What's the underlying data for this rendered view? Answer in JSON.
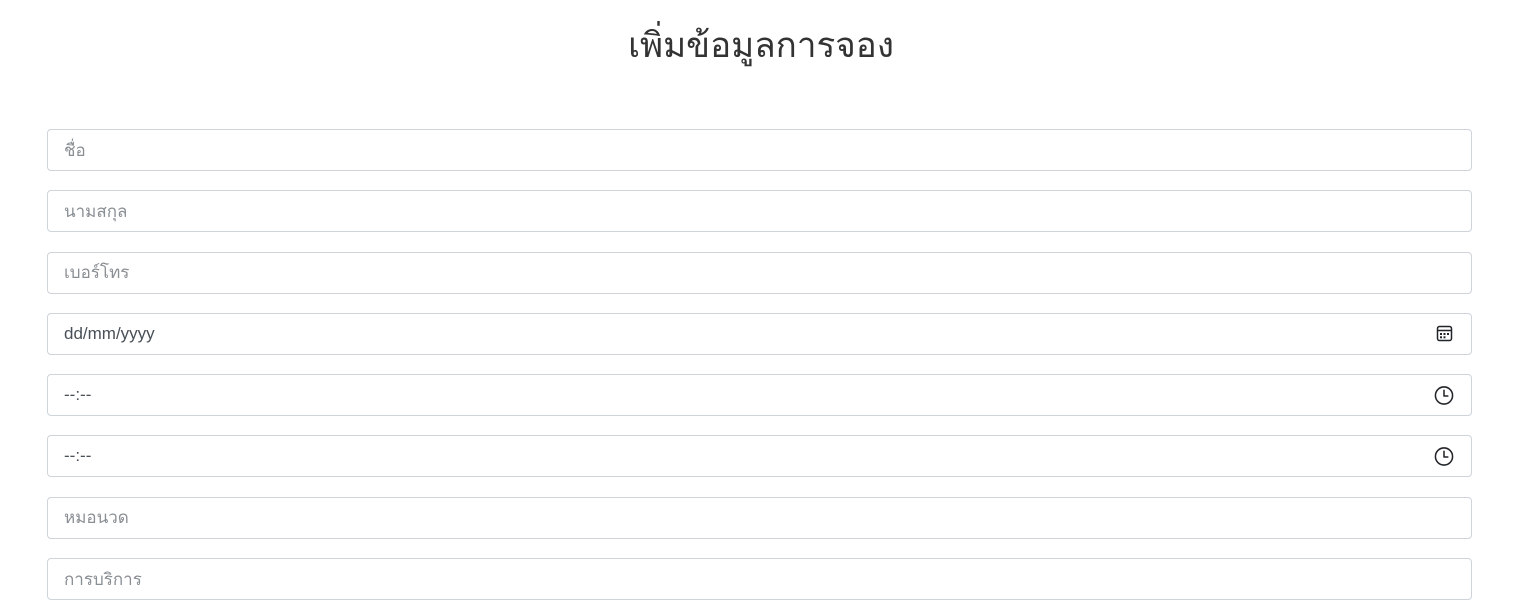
{
  "page": {
    "title": "เพิ่มข้อมูลการจอง"
  },
  "form": {
    "first_name": {
      "placeholder": "ชื่อ"
    },
    "last_name": {
      "placeholder": "นามสกุล"
    },
    "phone": {
      "placeholder": "เบอร์โทร"
    },
    "date": {
      "display": "dd/mm/yyyy",
      "icon": "calendar-icon"
    },
    "start_time": {
      "display": "--:--",
      "icon": "clock-icon"
    },
    "end_time": {
      "display": "--:--",
      "icon": "clock-icon"
    },
    "masseuse": {
      "placeholder": "หมอนวด"
    },
    "service": {
      "placeholder": "การบริการ"
    }
  }
}
